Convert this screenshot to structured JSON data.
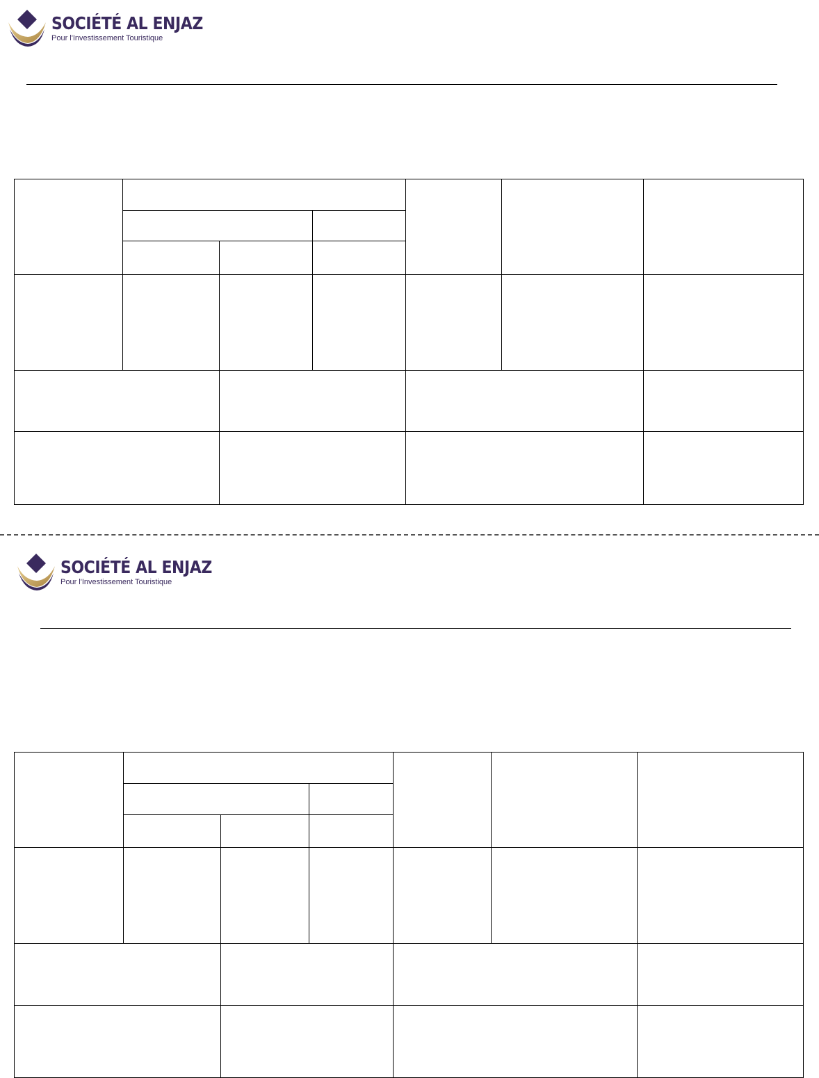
{
  "forms": [
    {
      "brand_name": "SOCIÉTÉ AL ENJAZ",
      "brand_tagline": "Pour l'Investissement Touristique"
    },
    {
      "brand_name": "SOCIÉTÉ AL ENJAZ",
      "brand_tagline": "Pour l'Investissement Touristique"
    }
  ],
  "colors": {
    "brand_purple": "#3a2a5e",
    "brand_gold": "#c9a45c"
  }
}
